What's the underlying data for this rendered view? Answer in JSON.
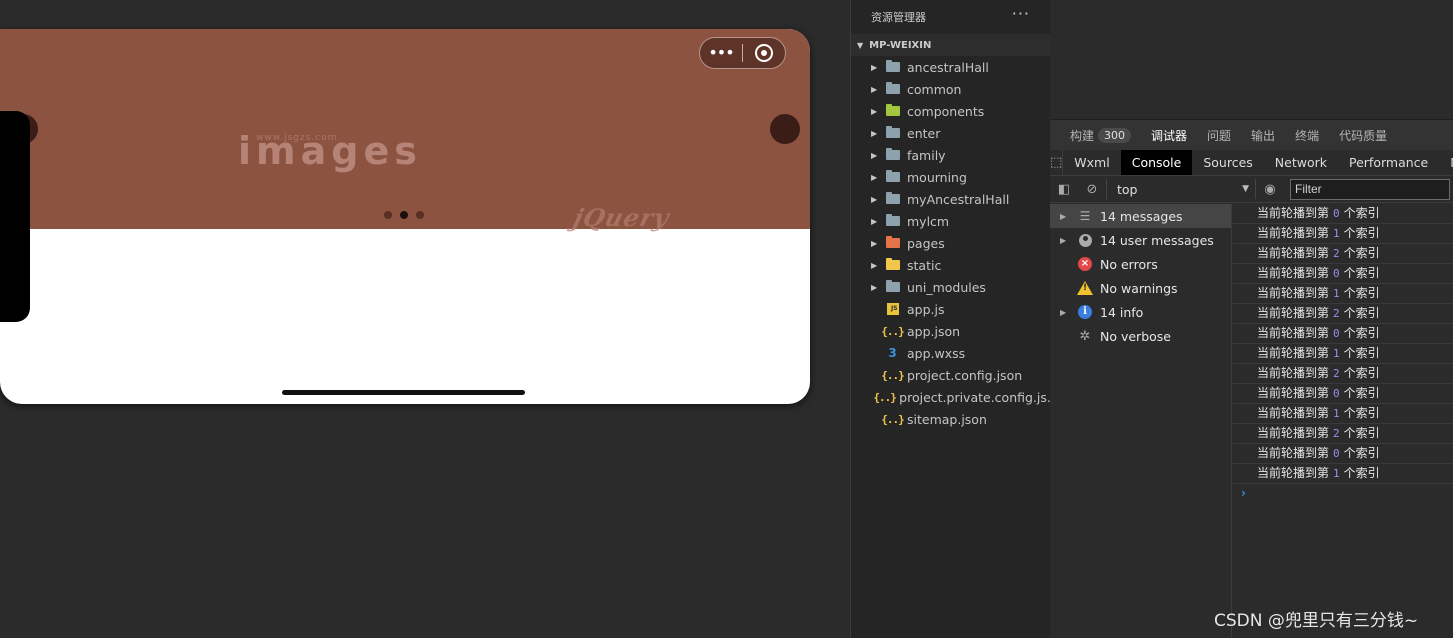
{
  "simulator": {
    "banner_text": "images",
    "banner_url": "www.jsgzs.com",
    "banner_stamp": "jQuery",
    "capsule_more": "•••",
    "pagination_count": 3,
    "active_dot": 1
  },
  "watermark": "CSDN @兜里只有三分钱~",
  "explorer": {
    "title": "资源管理器",
    "more": "···",
    "project": "MP-WEIXIN",
    "items": [
      {
        "label": "ancestralHall",
        "type": "folder",
        "color": "#8ea2ad"
      },
      {
        "label": "common",
        "type": "folder",
        "color": "#8ea2ad"
      },
      {
        "label": "components",
        "type": "folder",
        "color": "#a3c641"
      },
      {
        "label": "enter",
        "type": "folder",
        "color": "#8ea2ad"
      },
      {
        "label": "family",
        "type": "folder",
        "color": "#8ea2ad"
      },
      {
        "label": "mourning",
        "type": "folder",
        "color": "#8ea2ad"
      },
      {
        "label": "myAncestralHall",
        "type": "folder",
        "color": "#8ea2ad"
      },
      {
        "label": "mylcm",
        "type": "folder",
        "color": "#8ea2ad"
      },
      {
        "label": "pages",
        "type": "folder",
        "color": "#e5734a"
      },
      {
        "label": "static",
        "type": "folder",
        "color": "#f0c64b"
      },
      {
        "label": "uni_modules",
        "type": "folder",
        "color": "#8ea2ad"
      },
      {
        "label": "app.js",
        "type": "js"
      },
      {
        "label": "app.json",
        "type": "json"
      },
      {
        "label": "app.wxss",
        "type": "css"
      },
      {
        "label": "project.config.json",
        "type": "json"
      },
      {
        "label": "project.private.config.js...",
        "type": "json"
      },
      {
        "label": "sitemap.json",
        "type": "json"
      }
    ]
  },
  "devtools": {
    "top_tabs": [
      {
        "label": "构建",
        "badge": "300"
      },
      {
        "label": "调试器",
        "active": true
      },
      {
        "label": "问题"
      },
      {
        "label": "输出"
      },
      {
        "label": "终端"
      },
      {
        "label": "代码质量"
      }
    ],
    "panel_tabs": [
      "Wxml",
      "Console",
      "Sources",
      "Network",
      "Performance",
      "M"
    ],
    "active_panel": "Console",
    "context": "top",
    "filter_placeholder": "Filter",
    "sidebar": [
      {
        "label": "14 messages",
        "icon": "list",
        "expandable": true,
        "selected": true
      },
      {
        "label": "14 user messages",
        "icon": "user",
        "expandable": true
      },
      {
        "label": "No errors",
        "icon": "error",
        "expandable": false
      },
      {
        "label": "No warnings",
        "icon": "warning",
        "expandable": false
      },
      {
        "label": "14 info",
        "icon": "info",
        "expandable": true
      },
      {
        "label": "No verbose",
        "icon": "verbose",
        "expandable": false
      }
    ],
    "log_prefix": "当前轮播到第",
    "log_suffix": "个索引",
    "log_indices": [
      "0",
      "1",
      "2",
      "0",
      "1",
      "2",
      "0",
      "1",
      "2",
      "0",
      "1",
      "2",
      "0",
      "1"
    ],
    "prompt": "›"
  }
}
